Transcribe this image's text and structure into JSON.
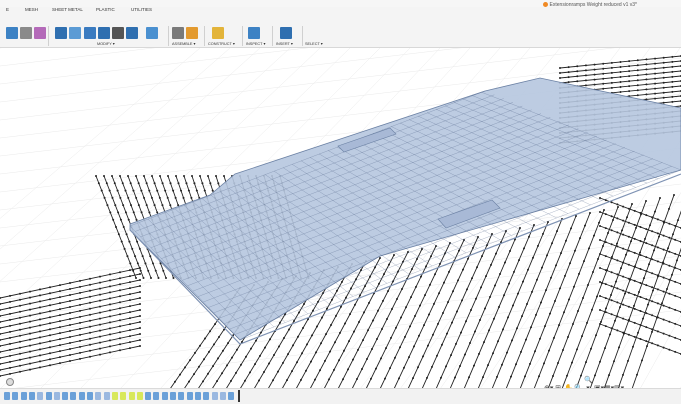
{
  "document": {
    "title": "Extensionramps Weight reduced v1 v3*"
  },
  "ribbon": {
    "tabs": [
      {
        "label": "E",
        "name": "tab-e"
      },
      {
        "label": "MESH",
        "name": "tab-mesh"
      },
      {
        "label": "SHEET METAL",
        "name": "tab-sheet-metal"
      },
      {
        "label": "PLASTIC",
        "name": "tab-plastic"
      },
      {
        "label": "UTILITIES",
        "name": "tab-utilities"
      }
    ],
    "groups": [
      {
        "label": "MODIFY ▾",
        "name": "group-modify"
      },
      {
        "label": "ASSEMBLE ▾",
        "name": "group-assemble"
      },
      {
        "label": "CONSTRUCT ▾",
        "name": "group-construct"
      },
      {
        "label": "INSPECT ▾",
        "name": "group-inspect"
      },
      {
        "label": "INSERT ▾",
        "name": "group-insert"
      },
      {
        "label": "SELECT ▾",
        "name": "group-select"
      }
    ],
    "icons": [
      {
        "name": "create-box-icon",
        "color": "#3d82c4"
      },
      {
        "name": "sketch-icon",
        "color": "#8a8a8a"
      },
      {
        "name": "form-icon",
        "color": "#b46ab9"
      },
      {
        "name": "press-pull-icon",
        "color": "#2f6fb0"
      },
      {
        "name": "fillet-icon",
        "color": "#5b9bd5"
      },
      {
        "name": "chamfer-icon",
        "color": "#3a7bc0"
      },
      {
        "name": "shell-icon",
        "color": "#2f6fb0"
      },
      {
        "name": "move-icon",
        "color": "#555555"
      },
      {
        "name": "align-icon",
        "color": "#2f6fb0"
      },
      {
        "name": "joint-icon",
        "color": "#4a90d0"
      },
      {
        "name": "as-built-joint-icon",
        "color": "#7a7a7a"
      },
      {
        "name": "offset-plane-icon",
        "color": "#e39a2f"
      },
      {
        "name": "measure-icon",
        "color": "#e3b43a"
      },
      {
        "name": "insert-image-icon",
        "color": "#3d82c4"
      },
      {
        "name": "select-icon",
        "color": "#2f6fb0"
      }
    ]
  },
  "viewport": {
    "surface_color": "#b6c6df",
    "edge_color": "#6b81a4",
    "mesh_line_color": "#5c6f90",
    "background_line_color": "#222222"
  },
  "nav_tools": [
    "⊕▾",
    "⊞",
    "✋",
    "🔍",
    "🔍▾",
    "▣▾",
    "▦▾",
    "▥▾"
  ],
  "timeline": {
    "item_colors": [
      "#6aa0d8",
      "#6aa0d8",
      "#6aa0d8",
      "#6aa0d8",
      "#9ab8e0",
      "#6aa0d8",
      "#9ab8e0",
      "#6aa0d8",
      "#6aa0d8",
      "#6aa0d8",
      "#6aa0d8",
      "#9ab8e0",
      "#9ab8e0",
      "#d8e85a",
      "#d8e85a",
      "#d8e85a",
      "#d8e85a",
      "#6aa0d8",
      "#6aa0d8",
      "#6aa0d8",
      "#6aa0d8",
      "#6aa0d8",
      "#6aa0d8",
      "#6aa0d8",
      "#6aa0d8",
      "#9ab8e0",
      "#9ab8e0",
      "#6aa0d8"
    ]
  }
}
